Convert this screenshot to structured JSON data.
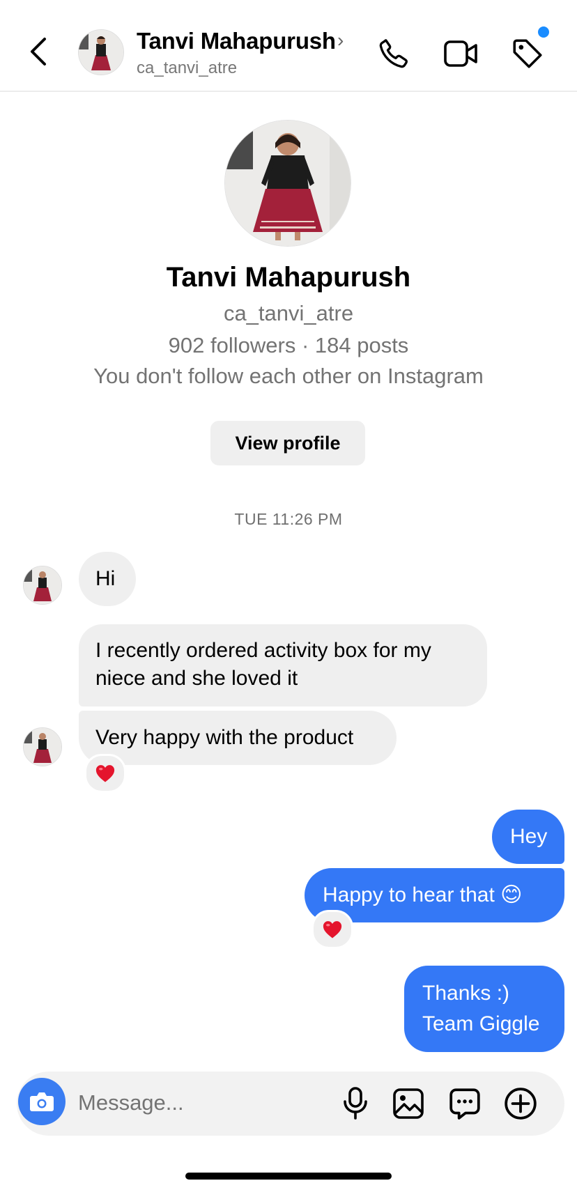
{
  "header": {
    "name": "Tanvi Mahapurush",
    "chevron": "›",
    "username": "ca_tanvi_atre",
    "icons": [
      "back-chevron-icon",
      "phone-icon",
      "video-camera-icon",
      "tag-icon"
    ],
    "notification_dot_color": "#1a8cff"
  },
  "profile": {
    "name": "Tanvi Mahapurush",
    "username": "ca_tanvi_atre",
    "stats": "902 followers · 184 posts",
    "relationship": "You don't follow each other on Instagram",
    "view_profile_label": "View profile"
  },
  "conversation": {
    "timestamp": "TUE 11:26 PM",
    "incoming": [
      {
        "lines": [
          "Hi"
        ]
      },
      {
        "lines": [
          "I recently ordered activity box for my",
          "niece and she loved it"
        ]
      },
      {
        "lines": [
          "Very happy with the product"
        ],
        "reaction": "❤️"
      }
    ],
    "outgoing": [
      {
        "lines": [
          "Hey"
        ]
      },
      {
        "lines": [
          "Happy to hear that 😊"
        ],
        "reaction": "❤️"
      },
      {
        "lines": [
          "Thanks :)",
          "Team Giggle"
        ]
      }
    ]
  },
  "composer": {
    "placeholder": "Message...",
    "icons": [
      "camera-icon",
      "microphone-icon",
      "gallery-icon",
      "sticker-chat-icon",
      "add-icon"
    ]
  },
  "colors": {
    "outgoing_bubble": "#3478f6",
    "incoming_bubble": "#efefef",
    "camera_button": "#3a7df2"
  }
}
